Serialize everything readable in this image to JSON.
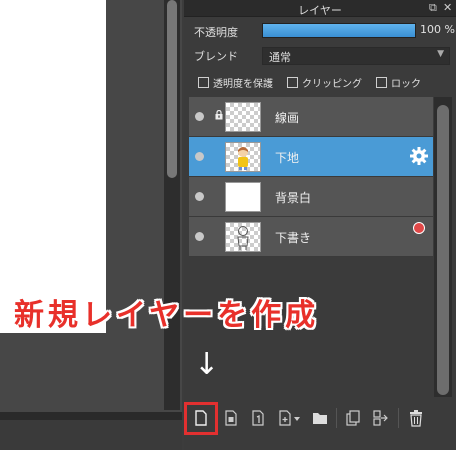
{
  "panel": {
    "title": "レイヤー",
    "opacity_label": "不透明度",
    "opacity_value": "100 %",
    "opacity_fraction": 1.0,
    "blend_label": "ブレンド",
    "blend_value": "通常",
    "checkboxes": [
      {
        "label": "透明度を保護",
        "checked": false
      },
      {
        "label": "クリッピング",
        "checked": false
      },
      {
        "label": "ロック",
        "checked": false
      }
    ]
  },
  "layers": [
    {
      "name": "線画",
      "locked": true,
      "selected": false,
      "thumb": "checker"
    },
    {
      "name": "下地",
      "locked": false,
      "selected": true,
      "thumb": "checker-figure"
    },
    {
      "name": "背景白",
      "locked": false,
      "selected": false,
      "thumb": "white"
    },
    {
      "name": "下書き",
      "locked": false,
      "selected": false,
      "thumb": "checker-sketch"
    }
  ],
  "toolbar": {
    "buttons": [
      "new-layer-icon",
      "new-layer-folder-icon",
      "new-layer-1bit-icon",
      "add-layer-menu-icon",
      "folder-icon",
      "duplicate-icon",
      "merge-icon",
      "trash-icon"
    ]
  },
  "annotation": {
    "text": "新規レイヤーを作成",
    "arrow": "↓"
  },
  "colors": {
    "accent": "#4a9bd6",
    "annotation": "#e8302a"
  }
}
